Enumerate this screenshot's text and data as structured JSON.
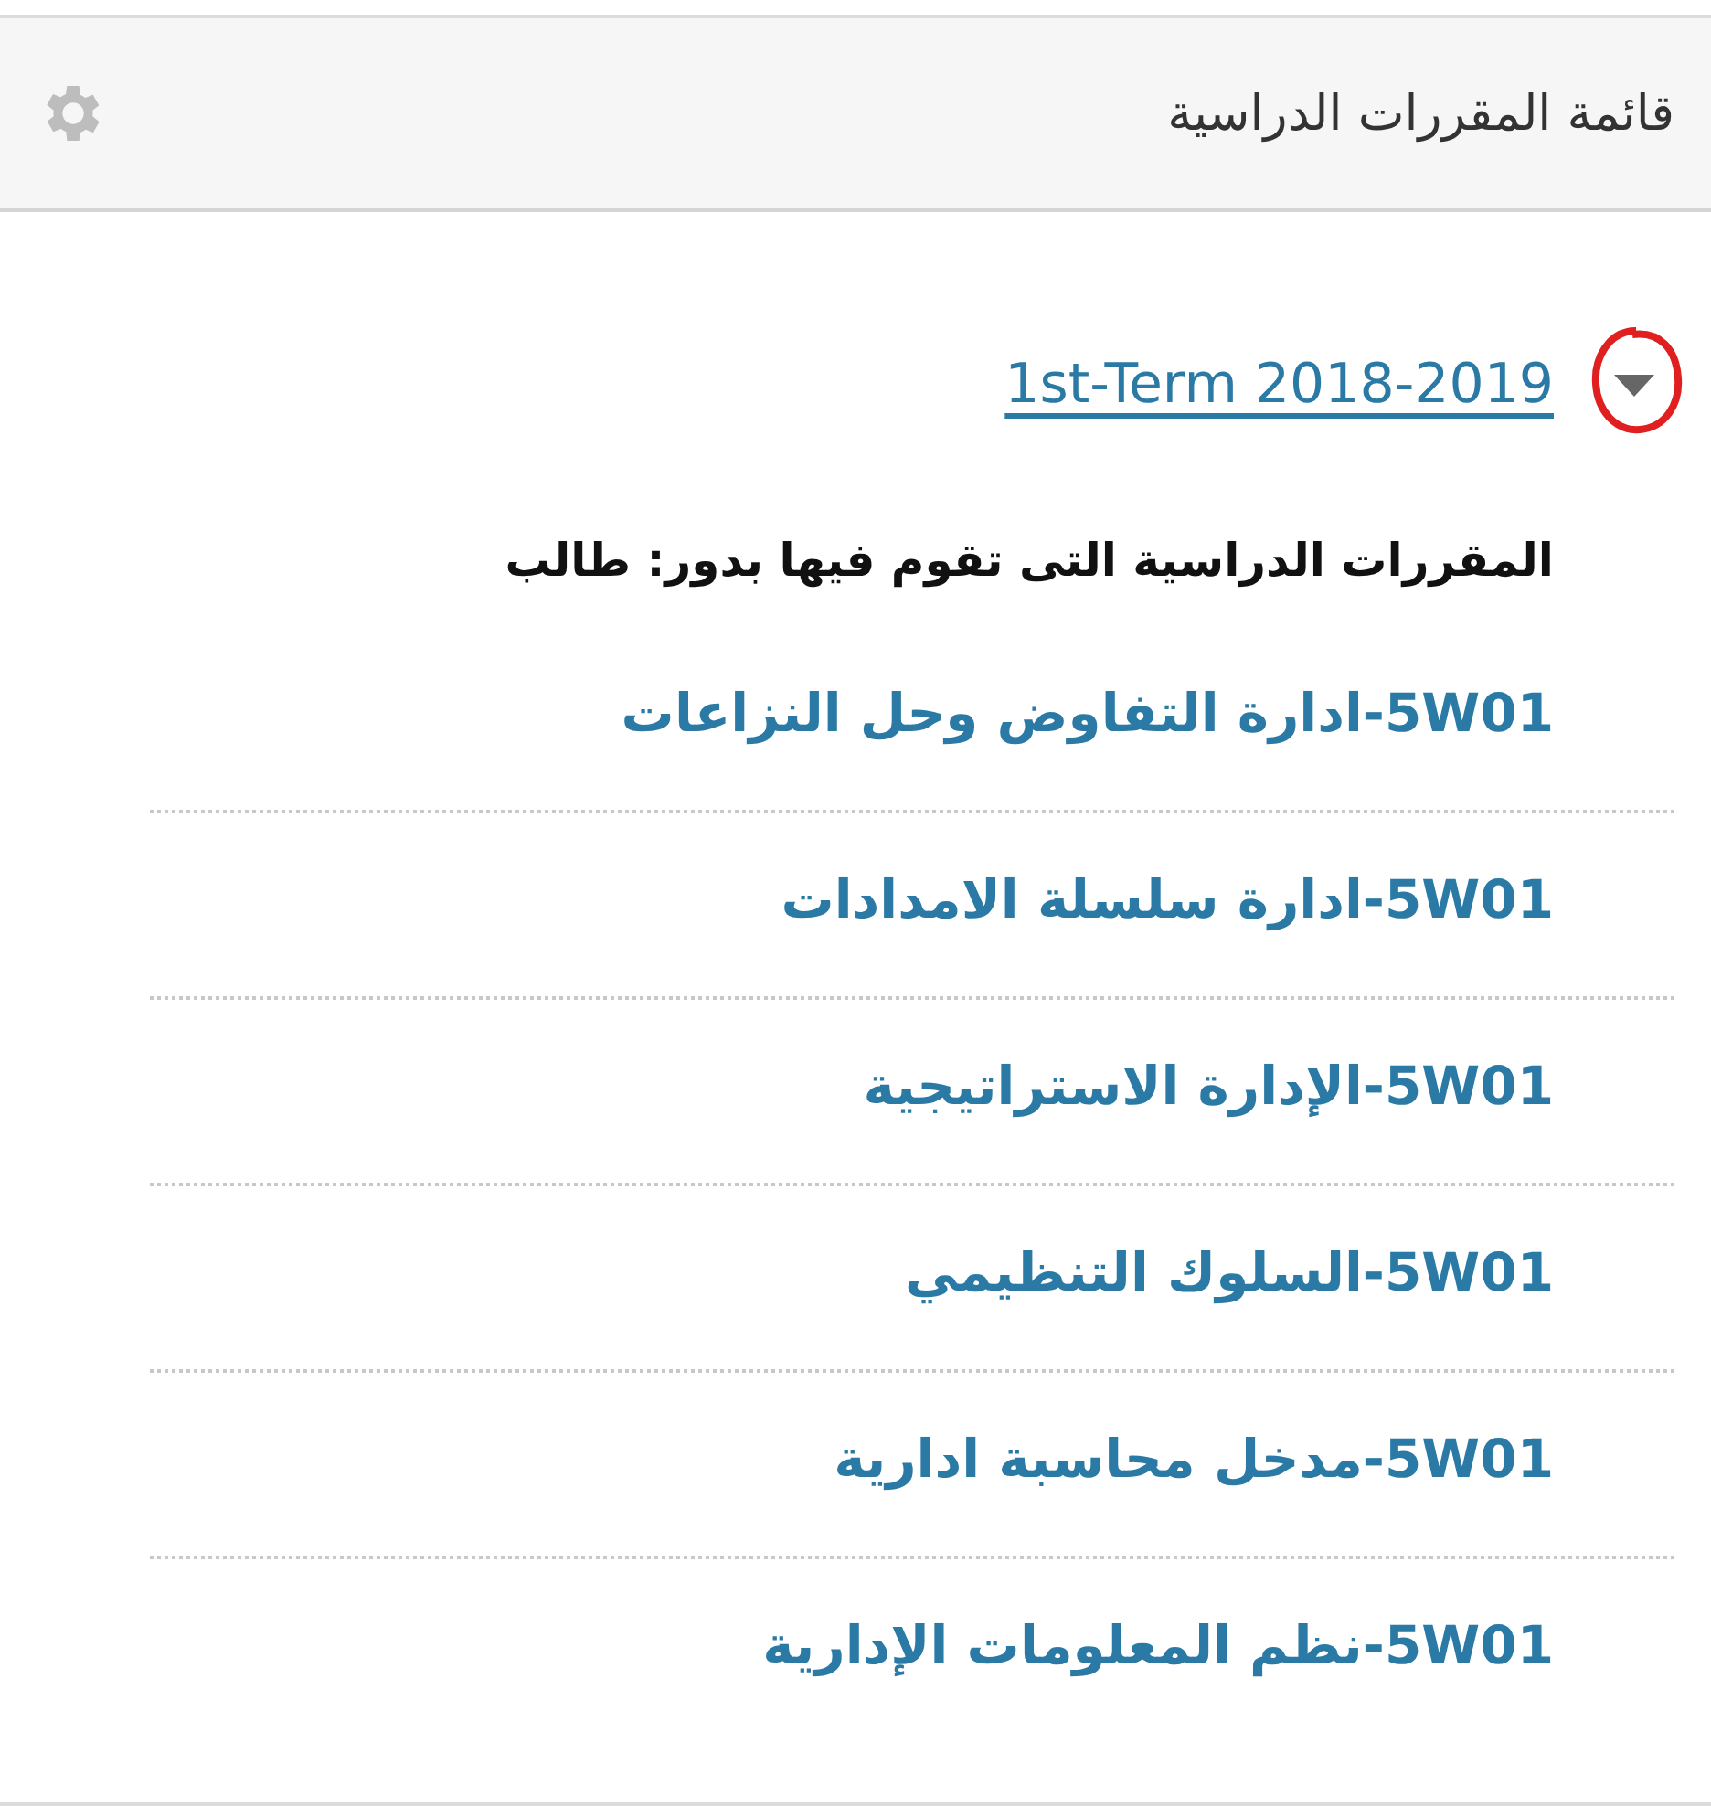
{
  "panel": {
    "title": "قائمة المقررات الدراسية"
  },
  "term": {
    "label": "1st-Term 2018-2019",
    "expanded": true,
    "circled": true
  },
  "role_heading": "المقررات الدراسية التى تقوم فيها بدور: طالب",
  "courses": [
    {
      "label": "5W01-ادارة التفاوض وحل النزاعات"
    },
    {
      "label": "5W01-ادارة سلسلة الامدادات"
    },
    {
      "label": "5W01-الإدارة الاستراتيجية"
    },
    {
      "label": "5W01-السلوك التنظيمي"
    },
    {
      "label": "5W01-مدخل محاسبة ادارية"
    },
    {
      "label": "5W01-نظم المعلومات الإدارية"
    }
  ]
}
